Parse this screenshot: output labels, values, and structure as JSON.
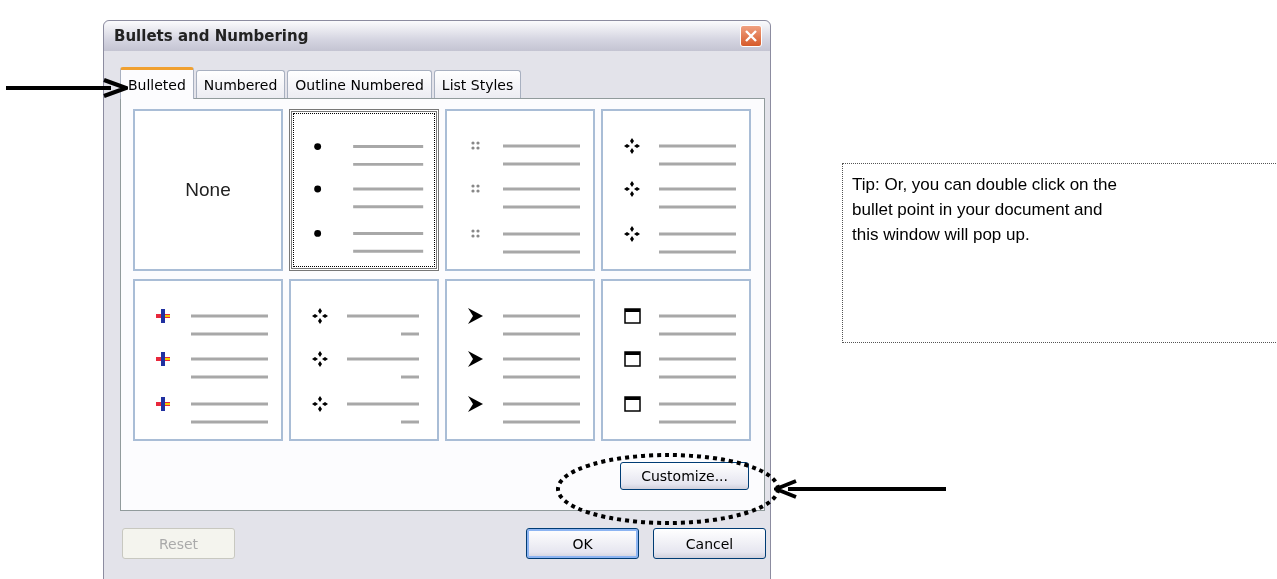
{
  "window": {
    "title": "Bullets and Numbering"
  },
  "tabs": [
    {
      "label": "Bulleted",
      "selected": true
    },
    {
      "label": "Numbered",
      "selected": false
    },
    {
      "label": "Outline Numbered",
      "selected": false
    },
    {
      "label": "List Styles",
      "selected": false
    }
  ],
  "gallery": [
    {
      "kind": "none",
      "label": "None",
      "selected": false
    },
    {
      "kind": "disc",
      "selected": true
    },
    {
      "kind": "dots",
      "selected": false
    },
    {
      "kind": "diamond",
      "selected": false
    },
    {
      "kind": "cross",
      "selected": false
    },
    {
      "kind": "diamond",
      "short_lines": true,
      "selected": false
    },
    {
      "kind": "arrowhead",
      "selected": false
    },
    {
      "kind": "square",
      "selected": false
    }
  ],
  "customize_button": "Customize...",
  "buttons": [
    {
      "label": "Reset",
      "disabled": true,
      "default": false
    },
    {
      "label": "OK",
      "disabled": false,
      "default": true
    },
    {
      "label": "Cancel",
      "disabled": false,
      "default": false
    }
  ],
  "tip": "Tip: Or, you can double click on the bullet point in your document and this window will pop up."
}
